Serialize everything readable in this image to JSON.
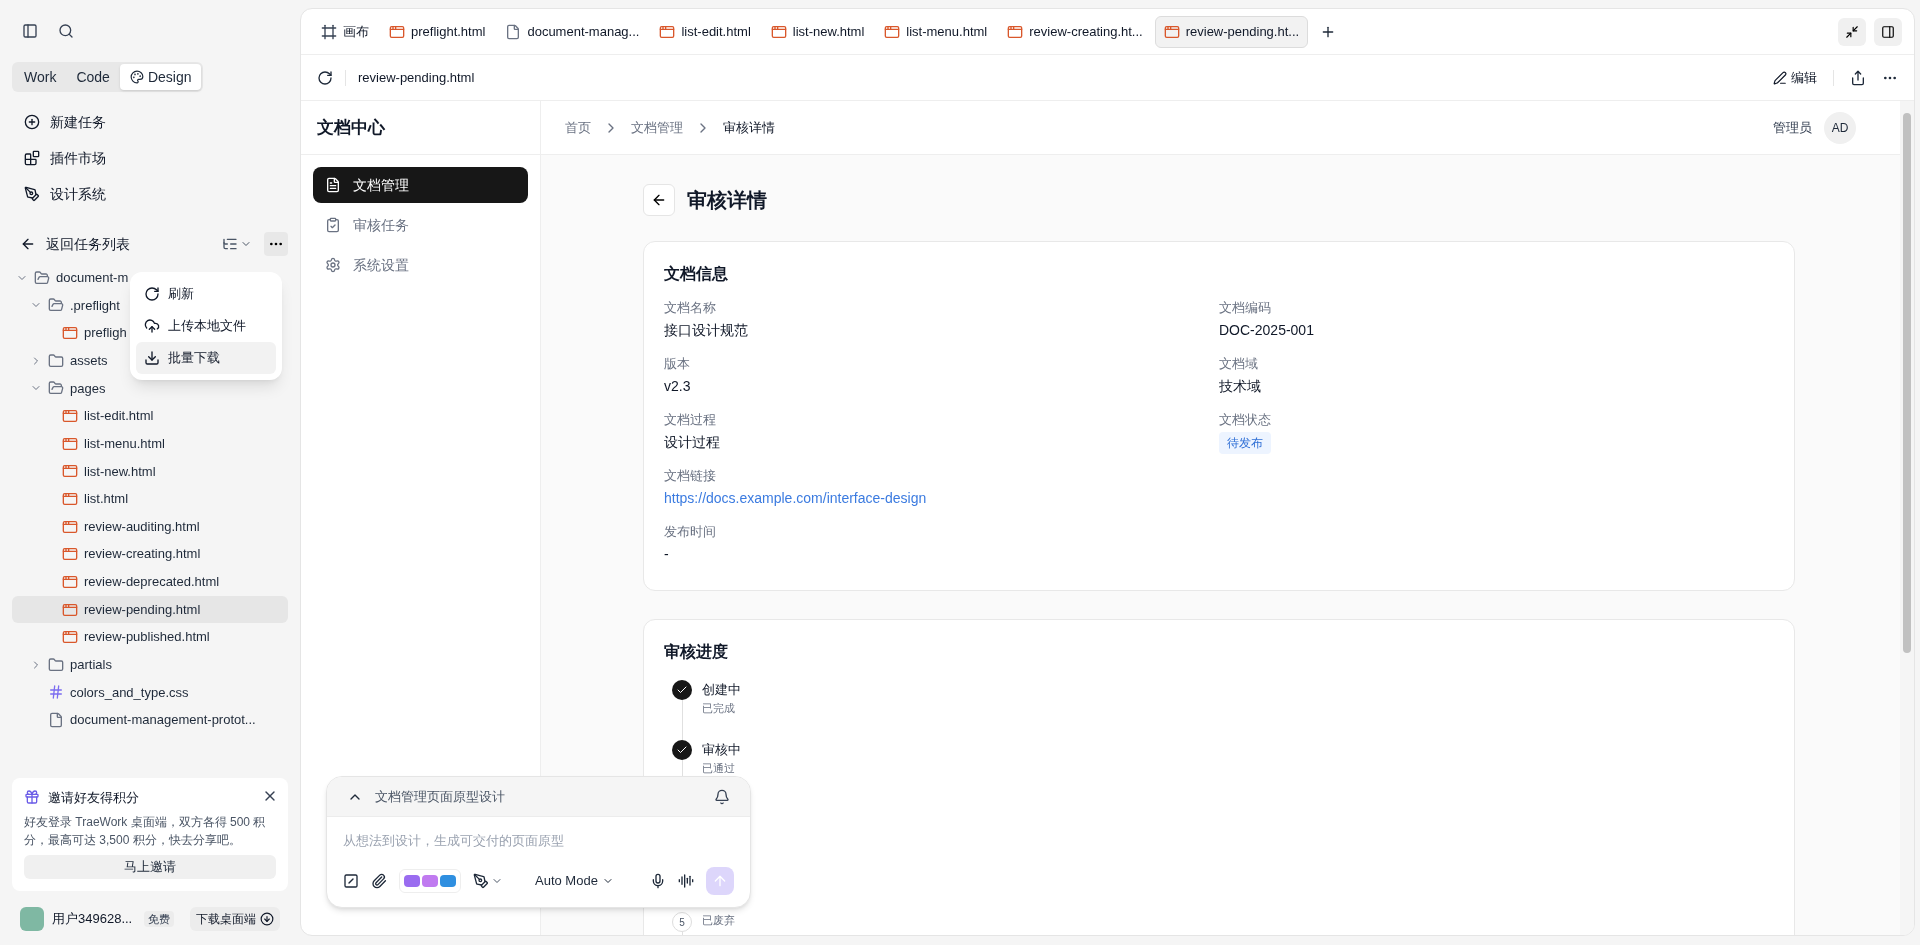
{
  "sidebar": {
    "modes": [
      {
        "label": "Work",
        "selected": false
      },
      {
        "label": "Code",
        "selected": false
      },
      {
        "label": "Design",
        "selected": true
      }
    ],
    "nav": [
      {
        "label": "新建任务",
        "kind": "new"
      },
      {
        "label": "插件市场",
        "kind": "plugins"
      },
      {
        "label": "设计系统",
        "kind": "design"
      }
    ],
    "back_label": "返回任务列表",
    "file_tree": [
      {
        "name": "document-m",
        "kind": "folder",
        "expanded": true,
        "selected": false,
        "children": [
          {
            "name": ".preflight",
            "kind": "folder",
            "expanded": true,
            "selected": false,
            "children": [
              {
                "name": "prefligh",
                "kind": "html",
                "selected": false
              }
            ]
          },
          {
            "name": "assets",
            "kind": "folder",
            "expanded": false,
            "selected": false
          },
          {
            "name": "pages",
            "kind": "folder",
            "expanded": true,
            "selected": false,
            "children": [
              {
                "name": "list-edit.html",
                "kind": "html",
                "selected": false
              },
              {
                "name": "list-menu.html",
                "kind": "html",
                "selected": false
              },
              {
                "name": "list-new.html",
                "kind": "html",
                "selected": false
              },
              {
                "name": "list.html",
                "kind": "html",
                "selected": false
              },
              {
                "name": "review-auditing.html",
                "kind": "html",
                "selected": false
              },
              {
                "name": "review-creating.html",
                "kind": "html",
                "selected": false
              },
              {
                "name": "review-deprecated.html",
                "kind": "html",
                "selected": false
              },
              {
                "name": "review-pending.html",
                "kind": "html",
                "selected": true
              },
              {
                "name": "review-published.html",
                "kind": "html",
                "selected": false
              }
            ]
          },
          {
            "name": "partials",
            "kind": "folder",
            "expanded": false,
            "selected": false
          },
          {
            "name": "colors_and_type.css",
            "kind": "css",
            "selected": false
          },
          {
            "name": "document-management-protot...",
            "kind": "file",
            "selected": false
          }
        ]
      }
    ],
    "context_menu": [
      {
        "label": "刷新",
        "kind": "refresh",
        "highlighted": false
      },
      {
        "label": "上传本地文件",
        "kind": "upload",
        "highlighted": false
      },
      {
        "label": "批量下载",
        "kind": "download",
        "highlighted": true
      }
    ],
    "invite": {
      "title": "邀请好友得积分",
      "text": "好友登录 TraeWork 桌面端，双方各得 500 积分，最高可达 3,500 积分，快去分享吧。",
      "button": "马上邀请"
    },
    "user": {
      "name": "用户349628...",
      "plan": "免费",
      "download": "下载桌面端"
    }
  },
  "tabs": [
    {
      "label": "画布",
      "kind": "canvas",
      "selected": false
    },
    {
      "label": "preflight.html",
      "kind": "html",
      "selected": false
    },
    {
      "label": "document-manag...",
      "kind": "file",
      "selected": false
    },
    {
      "label": "list-edit.html",
      "kind": "html",
      "selected": false
    },
    {
      "label": "list-new.html",
      "kind": "html",
      "selected": false
    },
    {
      "label": "list-menu.html",
      "kind": "html",
      "selected": false
    },
    {
      "label": "review-creating.ht...",
      "kind": "html",
      "selected": false
    },
    {
      "label": "review-pending.ht...",
      "kind": "html",
      "selected": true
    }
  ],
  "address": "review-pending.html",
  "edit_label": "编辑",
  "app": {
    "brand": "文档中心",
    "nav": [
      {
        "label": "文档管理",
        "kind": "docs",
        "selected": true
      },
      {
        "label": "审核任务",
        "kind": "tasks",
        "selected": false
      },
      {
        "label": "系统设置",
        "kind": "settings",
        "selected": false
      }
    ],
    "breadcrumb": [
      "首页",
      "文档管理",
      "审核详情"
    ],
    "user_role": "管理员",
    "avatar": "AD",
    "page_title": "审核详情",
    "info_title": "文档信息",
    "left_fields": [
      {
        "label": "文档名称",
        "value": "接口设计规范",
        "kind": "text"
      },
      {
        "label": "版本",
        "value": "v2.3",
        "kind": "text"
      },
      {
        "label": "文档过程",
        "value": "设计过程",
        "kind": "text"
      },
      {
        "label": "文档链接",
        "value": "https://docs.example.com/interface-design",
        "kind": "link"
      },
      {
        "label": "发布时间",
        "value": "-",
        "kind": "text"
      }
    ],
    "right_fields": [
      {
        "label": "文档编码",
        "value": "DOC-2025-001",
        "kind": "text"
      },
      {
        "label": "文档域",
        "value": "技术域",
        "kind": "text"
      },
      {
        "label": "文档状态",
        "value": "待发布",
        "kind": "badge"
      }
    ],
    "progress_title": "审核进度",
    "steps": [
      {
        "title": "创建中",
        "subtitle": "已完成",
        "done": true
      },
      {
        "title": "审核中",
        "subtitle": "已通过",
        "done": true
      },
      {
        "number": "5",
        "subtitle": "已废弃",
        "done": false
      }
    ]
  },
  "chat": {
    "title": "文档管理页面原型设计",
    "placeholder": "从想法到设计，生成可交付的页面原型",
    "mode": "Auto Mode"
  }
}
